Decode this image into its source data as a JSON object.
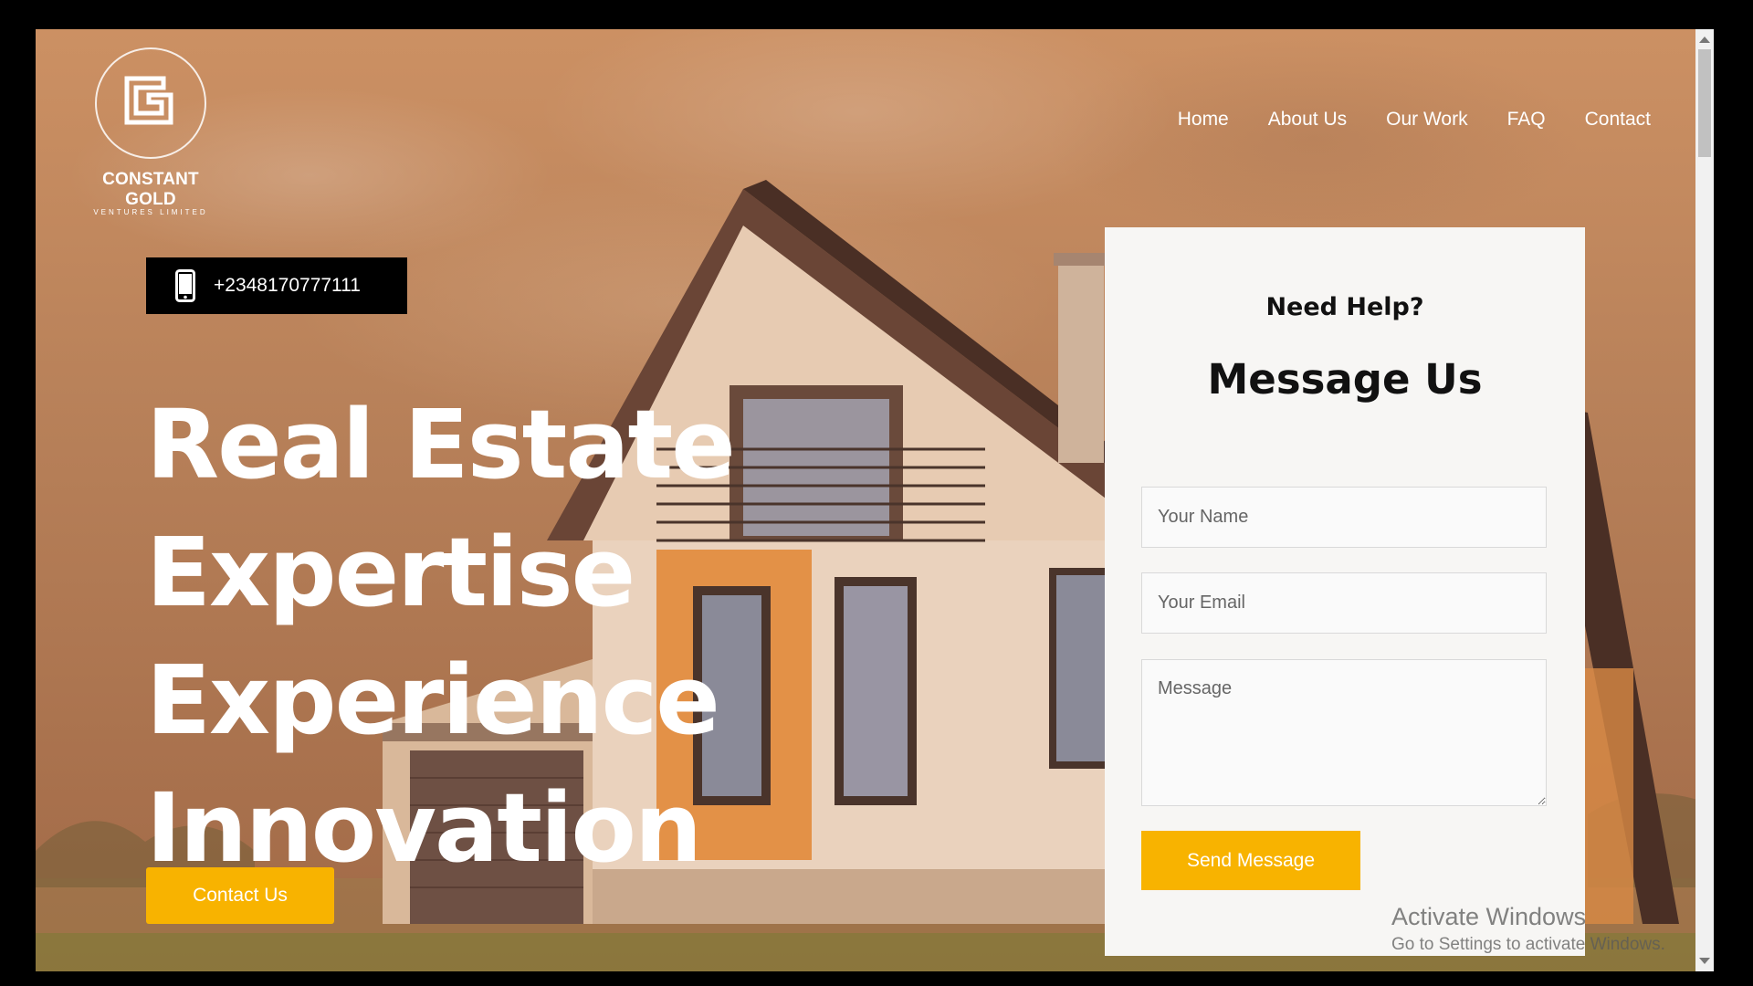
{
  "brand": {
    "name": "CONSTANT GOLD",
    "subtitle": "VENTURES LIMITED"
  },
  "nav": {
    "items": [
      "Home",
      "About Us",
      "Our Work",
      "FAQ",
      "Contact"
    ]
  },
  "phone": {
    "icon": "mobile-phone-icon",
    "number": "+2348170777111"
  },
  "hero": {
    "lines": [
      "Real Estate",
      "Expertise",
      "Experience",
      "Innovation"
    ],
    "cta_label": "Contact Us"
  },
  "form": {
    "eyebrow": "Need Help?",
    "title": "Message Us",
    "name_placeholder": "Your Name",
    "email_placeholder": "Your Email",
    "message_placeholder": "Message",
    "submit_label": "Send Message"
  },
  "watermark": {
    "line1": "Activate Windows",
    "line2": "Go to Settings to activate Windows."
  },
  "colors": {
    "accent": "#f8b300",
    "overlay": "#e2a06e",
    "card": "#f7f6f4"
  }
}
